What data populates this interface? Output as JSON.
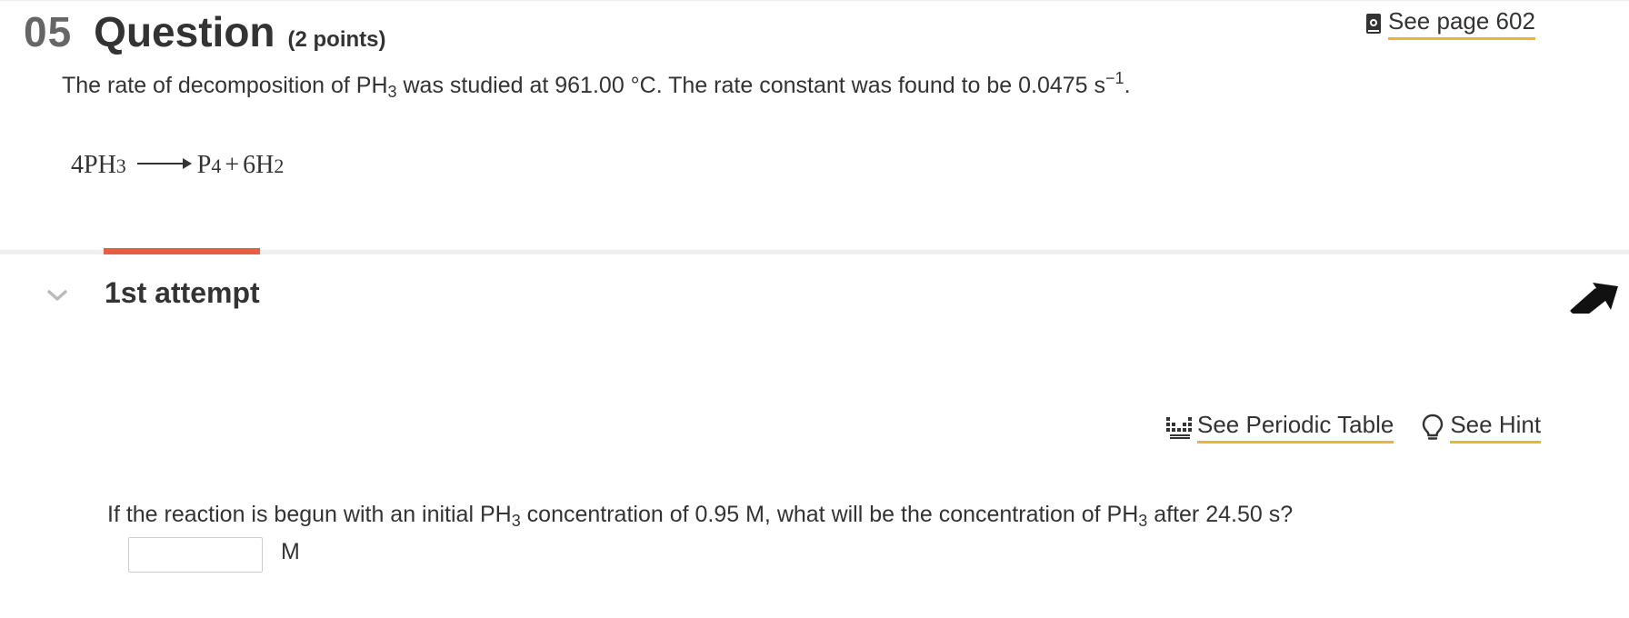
{
  "question": {
    "number": "05",
    "title": "Question",
    "points": "(2 points)",
    "see_page_label": "See page 602"
  },
  "statement": {
    "part1": "The rate of decomposition of PH",
    "sub1": "3",
    "part2": " was studied at 961.00 °C. The rate constant was found to be 0.0475  s",
    "sup1": "−1",
    "part3": "."
  },
  "equation": {
    "lhs": "4PH",
    "lhs_sub": "3",
    "p_prefix": "P",
    "p_sub": "4",
    "plus": "+",
    "h_prefix": "6H",
    "h_sub": "2"
  },
  "attempt": {
    "title": "1st attempt"
  },
  "tools": {
    "periodic_table_label": "See Periodic Table",
    "hint_label": "See Hint"
  },
  "prompt": {
    "part1": "If the reaction is begun with an initial PH",
    "sub1": "3",
    "part2": " concentration of 0.95 M, what will be the concentration of PH",
    "sub2": "3",
    "part3": " after 24.50  s?"
  },
  "answer": {
    "value": "",
    "unit": "M"
  },
  "colors": {
    "accent_tab": "#e35f42",
    "link_underline": "#e8b730",
    "text": "#333333"
  }
}
